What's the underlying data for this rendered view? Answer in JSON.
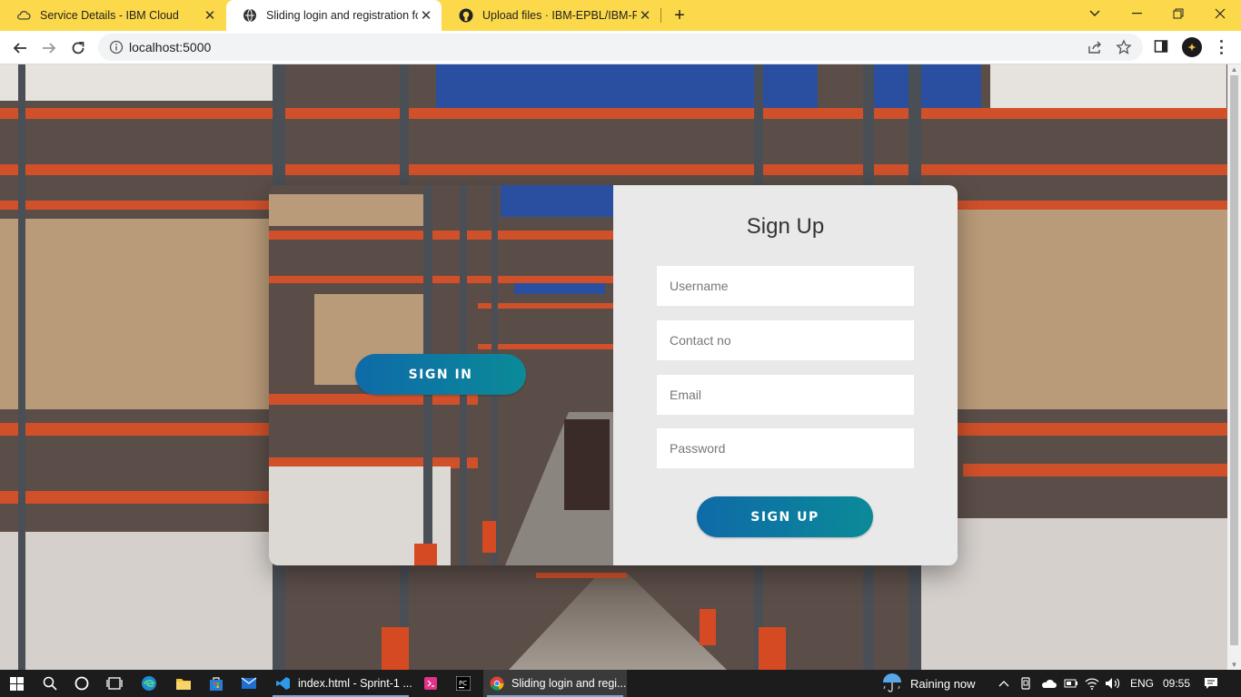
{
  "browser": {
    "tabs": [
      {
        "title": "Service Details - IBM Cloud",
        "icon": "ibm-cloud-icon",
        "active": false
      },
      {
        "title": "Sliding login and registration form",
        "icon": "globe-icon",
        "active": true
      },
      {
        "title": "Upload files · IBM-EPBL/IBM-Proj",
        "icon": "github-icon",
        "active": false
      }
    ],
    "address": "localhost:5000"
  },
  "form": {
    "title": "Sign Up",
    "username_placeholder": "Username",
    "contact_placeholder": "Contact no",
    "email_placeholder": "Email",
    "password_placeholder": "Password",
    "signup_label": "SIGN UP",
    "signin_label": "SIGN IN",
    "button_gradient": [
      "#0e6aa8",
      "#0b8a98"
    ]
  },
  "taskbar": {
    "apps": [
      {
        "label": "index.html - Sprint-1 ...",
        "icon": "vscode-icon"
      },
      {
        "label": "",
        "icon": "app-pink-icon"
      },
      {
        "label": "",
        "icon": "pycharm-icon"
      },
      {
        "label": "Sliding login and regi...",
        "icon": "chrome-icon"
      }
    ],
    "weather": "Raining now",
    "language": "ENG",
    "time": "09:55"
  },
  "colors": {
    "tabstrip": "#fcd94a",
    "taskbar": "#1c1c1c"
  }
}
